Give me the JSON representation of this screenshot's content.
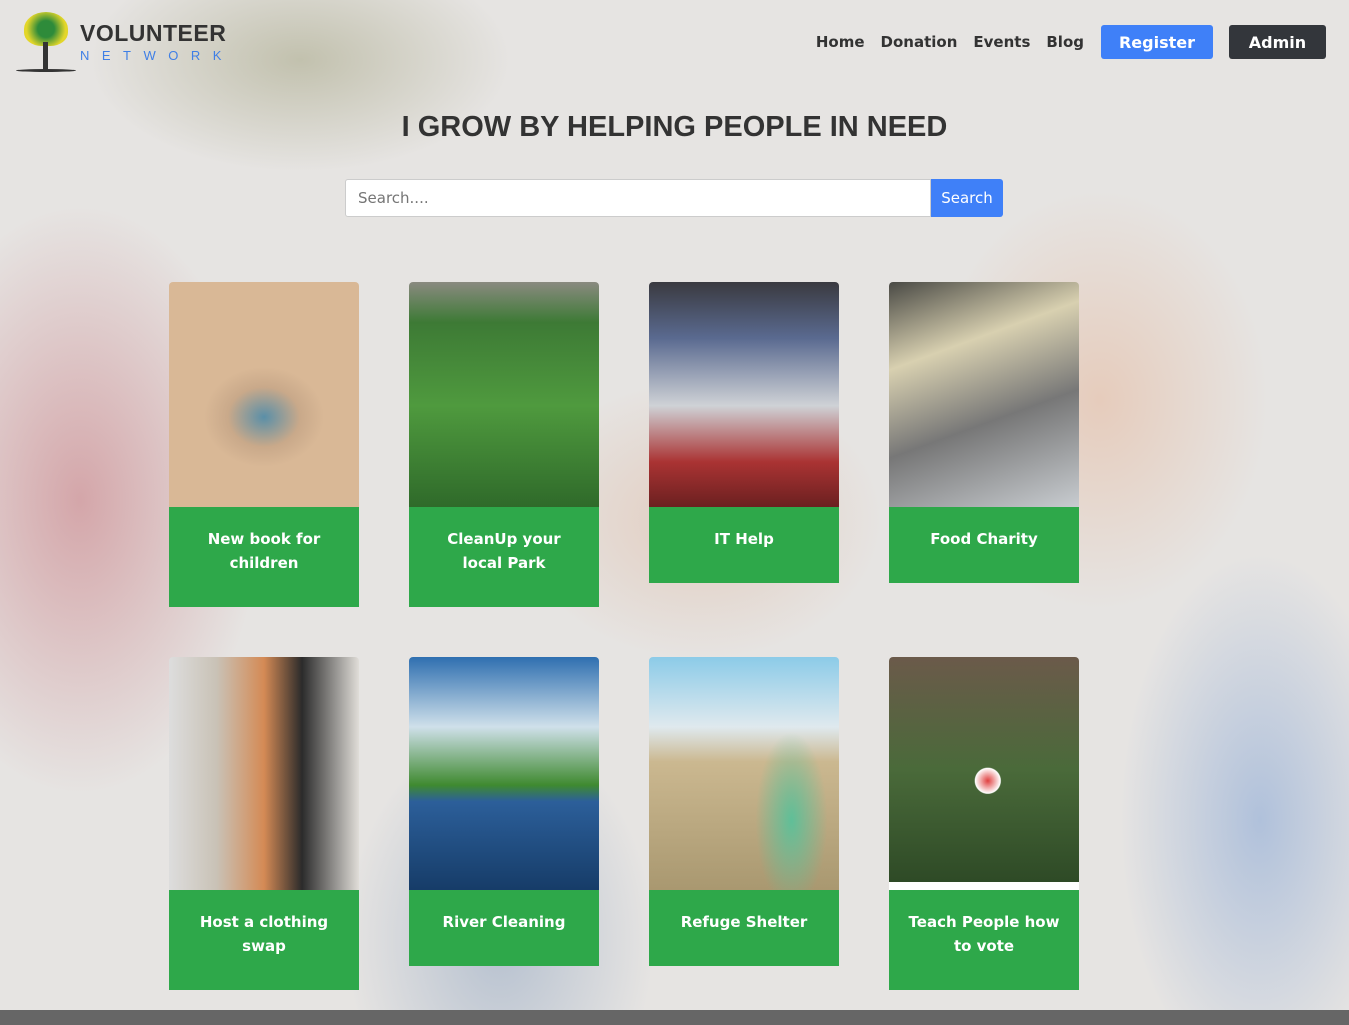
{
  "logo": {
    "line1": "VOLUNTEER",
    "line2": "NETWORK"
  },
  "nav": {
    "items": [
      "Home",
      "Donation",
      "Events",
      "Blog"
    ],
    "register": "Register",
    "admin": "Admin"
  },
  "hero": {
    "title": "I GROW BY HELPING PEOPLE IN NEED"
  },
  "search": {
    "placeholder": "Search....",
    "button": "Search"
  },
  "colors": {
    "primary": "#3f80f8",
    "card_green": "#2ea84a",
    "dark": "#33363b"
  },
  "cards": [
    {
      "title": "New book for children",
      "image": "books"
    },
    {
      "title": "CleanUp your local Park",
      "image": "park"
    },
    {
      "title": "IT Help",
      "image": "laptop"
    },
    {
      "title": "Food Charity",
      "image": "food-donation"
    },
    {
      "title": "Host a clothing swap",
      "image": "clothes-rack"
    },
    {
      "title": "River Cleaning",
      "image": "river"
    },
    {
      "title": "Refuge Shelter",
      "image": "child"
    },
    {
      "title": "Teach People how to vote",
      "image": "voted-sticker"
    }
  ]
}
